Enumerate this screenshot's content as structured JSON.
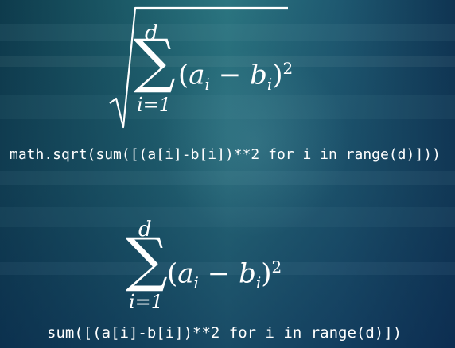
{
  "formula1": {
    "upper": "d",
    "lower": "i=1",
    "term_a": "a",
    "term_b": "b",
    "sub": "i",
    "exponent": "2"
  },
  "code1": "math.sqrt(sum([(a[i]-b[i])**2 for i in range(d)]))",
  "formula2": {
    "upper": "d",
    "lower": "i=1",
    "term_a": "a",
    "term_b": "b",
    "sub": "i",
    "exponent": "2"
  },
  "code2": "sum([(a[i]-b[i])**2 for i in range(d)])"
}
